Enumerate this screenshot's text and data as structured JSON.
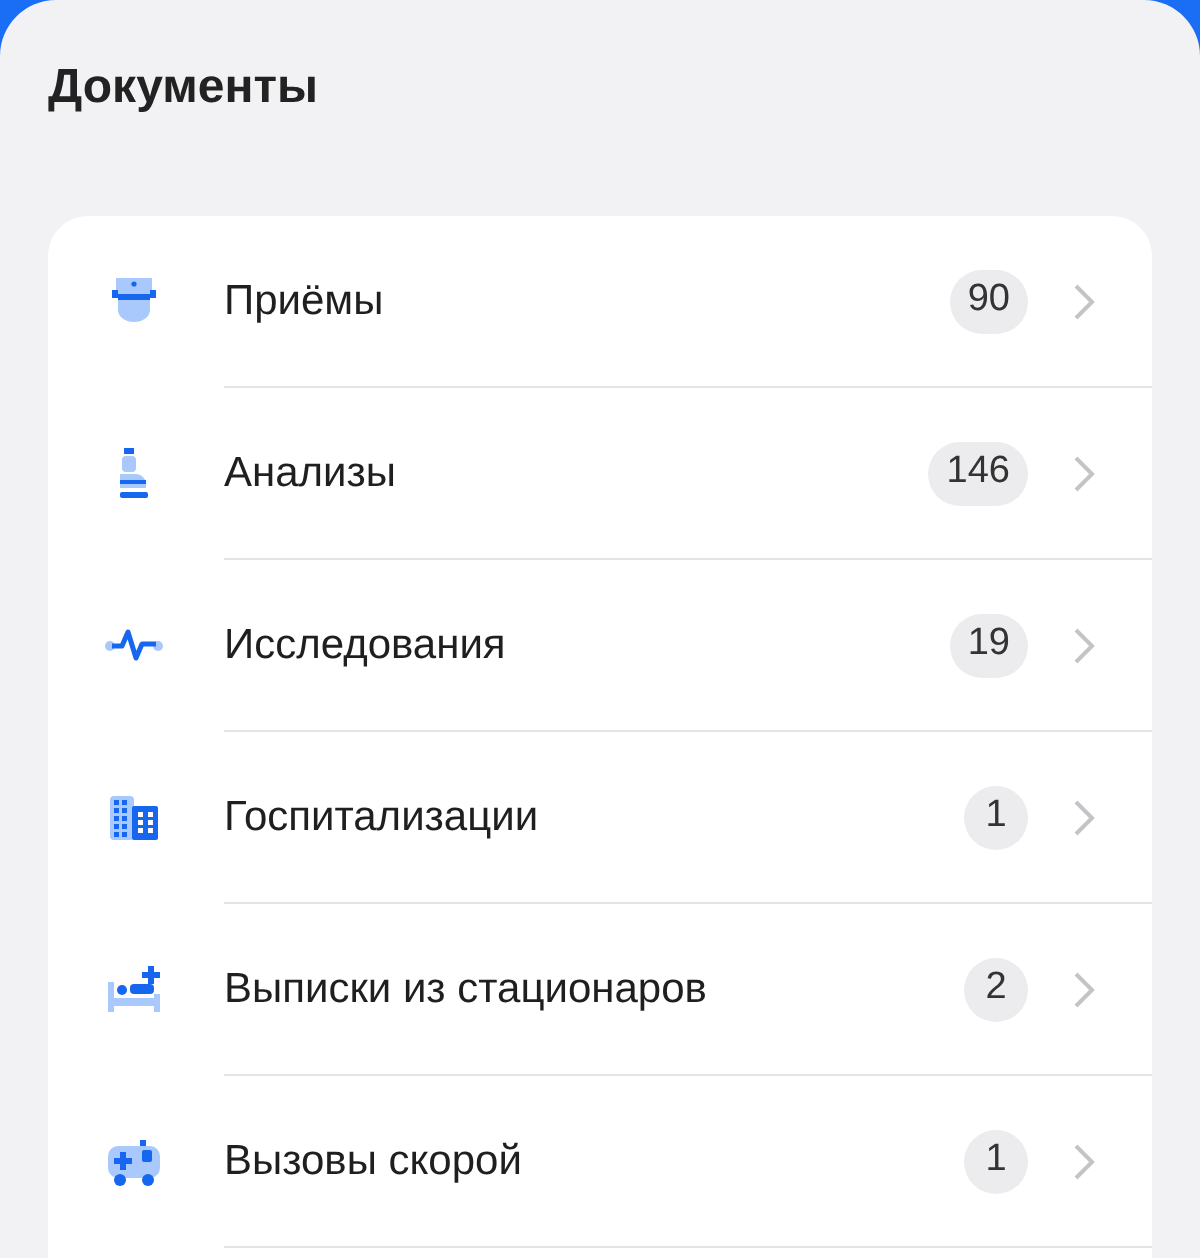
{
  "title": "Документы",
  "items": [
    {
      "label": "Приёмы",
      "count": "90"
    },
    {
      "label": "Анализы",
      "count": "146"
    },
    {
      "label": "Исследования",
      "count": "19"
    },
    {
      "label": "Госпитализации",
      "count": "1"
    },
    {
      "label": "Выписки из стационаров",
      "count": "2"
    },
    {
      "label": "Вызовы скорой",
      "count": "1"
    }
  ]
}
